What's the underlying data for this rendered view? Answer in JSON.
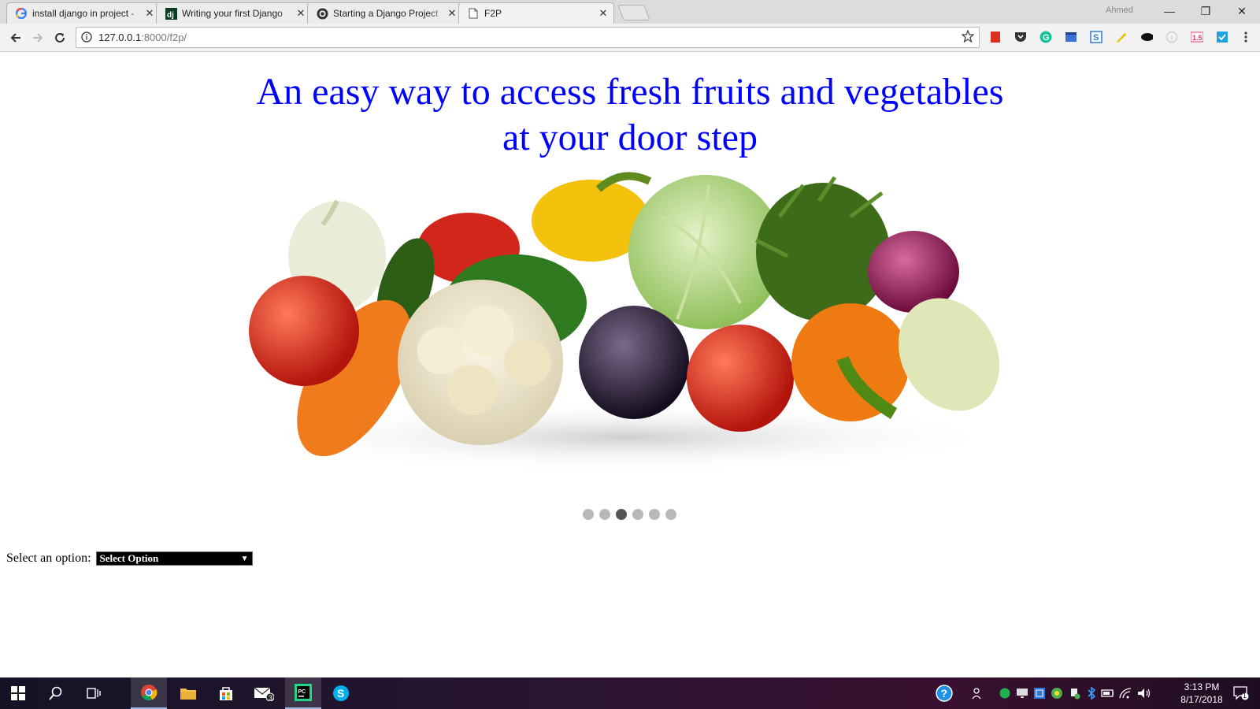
{
  "browser": {
    "tabs": [
      {
        "title": "install django in project -",
        "icon": "google-icon"
      },
      {
        "title": "Writing your first Django",
        "icon": "django-icon"
      },
      {
        "title": "Starting a Django Project",
        "icon": "github-icon"
      },
      {
        "title": "F2P",
        "icon": "page-icon"
      }
    ],
    "profile_name": "Ahmed",
    "address": {
      "host": "127.0.0.1",
      "path": ":8000/f2p/"
    },
    "window_controls": [
      "minimize-icon",
      "restore-icon",
      "close-icon"
    ]
  },
  "page": {
    "headline_line1": "An easy way to access fresh fruits and vegetables",
    "headline_line2": "at your door step",
    "carousel": {
      "slide_count": 6,
      "active_index": 2,
      "image_subject": "assorted-vegetables"
    },
    "form": {
      "label": "Select an option:",
      "select_value": "Select Option"
    }
  },
  "taskbar": {
    "apps": [
      "start-icon",
      "search-icon",
      "task-view-icon",
      "chrome-icon",
      "file-explorer-icon",
      "store-icon",
      "mail-icon",
      "pycharm-icon",
      "skype-icon"
    ],
    "mail_badge": "3",
    "notification_count": "1",
    "clock_time": "3:13 PM",
    "clock_date": "8/17/2018"
  },
  "colors": {
    "headline": "#0000ff",
    "select_bg": "#000000",
    "dot_active": "#555555",
    "dot_inactive": "#b8b8b8"
  }
}
